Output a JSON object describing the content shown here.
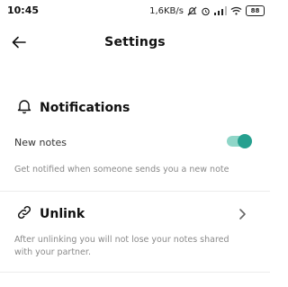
{
  "status_bar": {
    "time": "10:45",
    "net_speed": "1,6KB/s",
    "battery": "88"
  },
  "header": {
    "title": "Settings"
  },
  "notifications": {
    "title": "Notifications",
    "new_notes_label": "New notes",
    "new_notes_enabled": true,
    "description": "Get notified when someone sends you a new note"
  },
  "unlink": {
    "title": "Unlink",
    "description": "After unlinking you will not lose your notes shared with your partner."
  },
  "colors": {
    "accent": "#26a08f",
    "accent_track": "#8fd6c8",
    "hint_text": "#8a8a8a"
  }
}
